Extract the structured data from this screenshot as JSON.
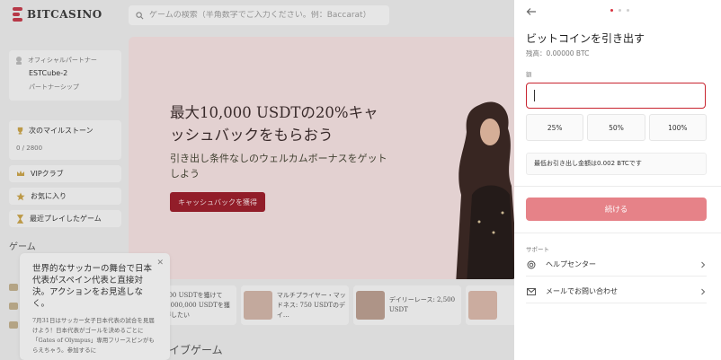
{
  "app": {
    "brand": "BITCASINO",
    "search_placeholder": "ゲームの検索（半角数字でご入力ください。例：Baccarat）"
  },
  "sidebar": {
    "partner_label": "オフィシャルパートナー",
    "partner_name": "ESTCube-2",
    "partnership": "パートナーシップ",
    "milestone_title": "次のマイルストーン",
    "milestone_count": "0 / 2800",
    "items": [
      {
        "label": "VIPクラブ"
      },
      {
        "label": "お気に入り"
      },
      {
        "label": "最近プレイしたゲーム"
      }
    ],
    "games_heading": "ゲーム"
  },
  "hero": {
    "title": "最大10,000 USDTの20%キャッシュバックをもらおう",
    "subtitle": "引き出し条件なしのウェルカムボーナスをゲットしよう",
    "cta": "キャッシュバックを獲得"
  },
  "promos": [
    {
      "text": "400 USDTを獲けて2,000,000 USDTを獲得したい"
    },
    {
      "text": "マルチプライヤー・マッドネス: 750 USDTのデイ…"
    },
    {
      "text": "デイリーレース: 2,500 USDT"
    },
    {
      "text": ""
    }
  ],
  "live_games_heading": "イブゲーム",
  "notice": {
    "title": "世界的なサッカーの舞台で日本代表がスペイン代表と直接対決。アクションをお見逃しなく。",
    "body": "7月31日はサッカー女子日本代表の試合を見届けよう！日本代表がゴールを決めるごとに「Gates of Olympus」専用フリースピンがもらえちゃう。参加するに"
  },
  "withdraw": {
    "title": "ビットコインを引き出す",
    "balance": "残高：0.00000 BTC",
    "amount_label": "額",
    "amount_value": "",
    "percent_buttons": [
      "25%",
      "50%",
      "100%"
    ],
    "min_withdrawal": "最低お引き出し金額は0.002 BTCです",
    "continue_label": "続ける",
    "support_heading": "サポート",
    "help_center": "ヘルプセンター",
    "email_contact": "メールでお問い合わせ",
    "step_count": 3,
    "active_step": 1
  },
  "colors": {
    "accent": "#c8242f",
    "continue_disabled": "#e68288",
    "hero_bg": "#f1dede",
    "panel_bg": "#ffffff"
  }
}
